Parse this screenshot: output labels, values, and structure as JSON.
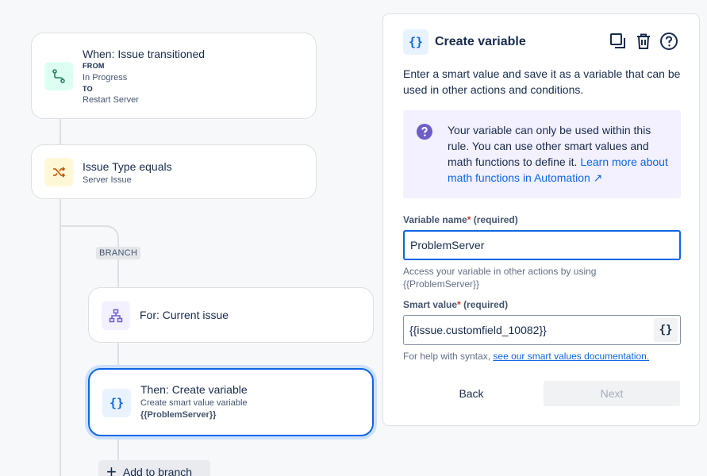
{
  "flow": {
    "trigger": {
      "title": "When: Issue transitioned",
      "from_label": "FROM",
      "from_value": "In Progress",
      "to_label": "TO",
      "to_value": "Restart Server",
      "icon": "transition-icon"
    },
    "condition": {
      "title": "Issue Type equals",
      "subtitle": "Server Issue",
      "icon": "shuffle-icon"
    },
    "branch_tag": "BRANCH",
    "branch": {
      "title": "For: Current issue",
      "icon": "hierarchy-icon"
    },
    "action": {
      "title": "Then: Create variable",
      "subtitle": "Create smart value variable",
      "variable": "{{ProblemServer}}",
      "icon": "braces-icon"
    },
    "add_to_branch": "Add to branch"
  },
  "panel": {
    "title": "Create variable",
    "description": "Enter a smart value and save it as a variable that can be used in other actions and conditions.",
    "info_text": "Your variable can only be used within this rule. You can use other smart values and math functions to define it. ",
    "info_link": "Learn more about math functions in Automation ↗",
    "variable_name_label": "Variable name",
    "required_star": "*",
    "required_text": "(required)",
    "variable_name_value": "ProblemServer",
    "variable_help": "Access your variable in other actions by using {{ProblemServer}}",
    "smart_value_label": "Smart value",
    "smart_value_value": "{{issue.customfield_10082}}",
    "syntax_help_prefix": "For help with syntax, ",
    "syntax_help_link": "see our smart values documentation.",
    "back_label": "Back",
    "next_label": "Next"
  },
  "colors": {
    "accent": "#0c66e4",
    "trigger_icon_bg": "#dcfff1",
    "condition_icon_bg": "#fff7d6",
    "branch_icon_bg": "#f3f0ff",
    "info_bg": "#f3f0ff",
    "info_icon": "#6e5dc6"
  }
}
